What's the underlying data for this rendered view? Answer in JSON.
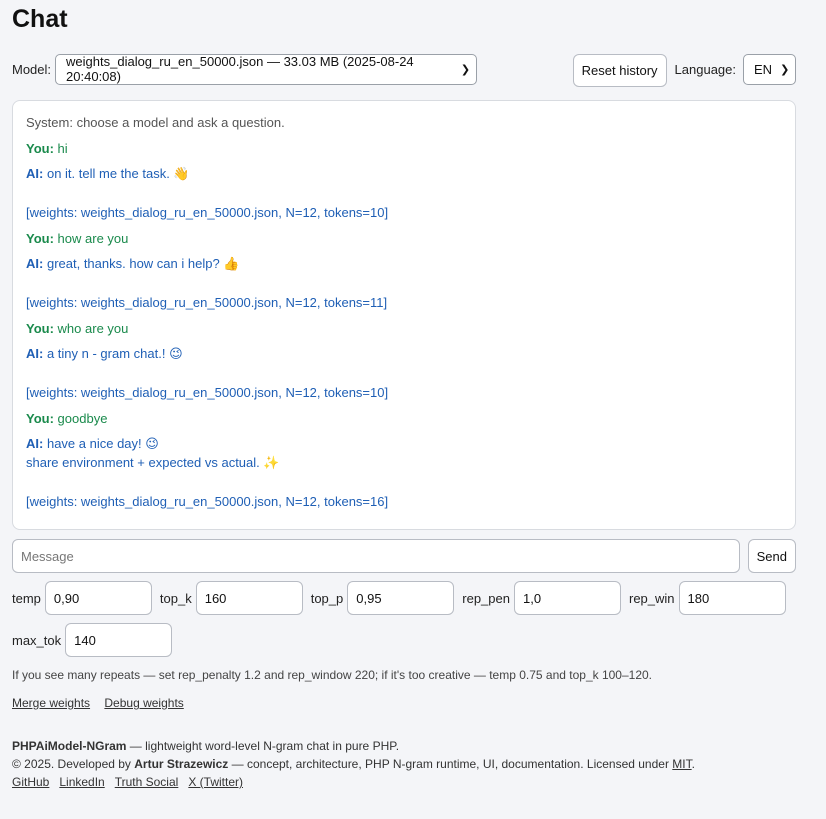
{
  "title": "Chat",
  "toolbar": {
    "model_label": "Model:",
    "model_value": "weights_dialog_ru_en_50000.json — 33.03 MB (2025-08-24 20:40:08)",
    "reset_label": "Reset history",
    "language_label": "Language:",
    "language_value": "EN"
  },
  "chat": {
    "system": "System: choose a model and ask a question.",
    "you_prefix": "You:",
    "ai_prefix": "AI:",
    "turns": [
      {
        "you": "hi",
        "ai": [
          "on it. tell me the task. 👋"
        ],
        "meta": "[weights: weights_dialog_ru_en_50000.json, N=12, tokens=10]"
      },
      {
        "you": "how are you",
        "ai": [
          "great, thanks. how can i help? 👍"
        ],
        "meta": "[weights: weights_dialog_ru_en_50000.json, N=12, tokens=11]"
      },
      {
        "you": "who are you",
        "ai": [
          "a tiny n - gram chat.! 😉"
        ],
        "meta": "[weights: weights_dialog_ru_en_50000.json, N=12, tokens=10]"
      },
      {
        "you": "goodbye",
        "ai": [
          "have a nice day! 😉",
          "share environment + expected vs actual. ✨"
        ],
        "meta": "[weights: weights_dialog_ru_en_50000.json, N=12, tokens=16]"
      }
    ]
  },
  "composer": {
    "placeholder": "Message",
    "send_label": "Send"
  },
  "params": [
    {
      "label": "temp",
      "value": "0,90"
    },
    {
      "label": "top_k",
      "value": "160"
    },
    {
      "label": "top_p",
      "value": "0,95"
    },
    {
      "label": "rep_pen",
      "value": "1,0"
    },
    {
      "label": "rep_win",
      "value": "180"
    },
    {
      "label": "max_tok",
      "value": "140"
    }
  ],
  "hint": "If you see many repeats — set rep_penalty 1.2 and rep_window 220; if it's too creative — temp 0.75 and top_k 100–120.",
  "links": {
    "merge": "Merge weights",
    "debug": "Debug weights"
  },
  "footer": {
    "product": "PHPAiModel-NGram",
    "tagline": " — lightweight word-level N-gram chat in pure PHP.",
    "copyright_pre": "© 2025. Developed by ",
    "author": "Artur Strazewicz",
    "copyright_post": " — concept, architecture, PHP N-gram runtime, UI, documentation. Licensed under ",
    "license": "MIT",
    "period": ".",
    "social": [
      "GitHub",
      "LinkedIn",
      "Truth Social",
      "X (Twitter)"
    ]
  }
}
